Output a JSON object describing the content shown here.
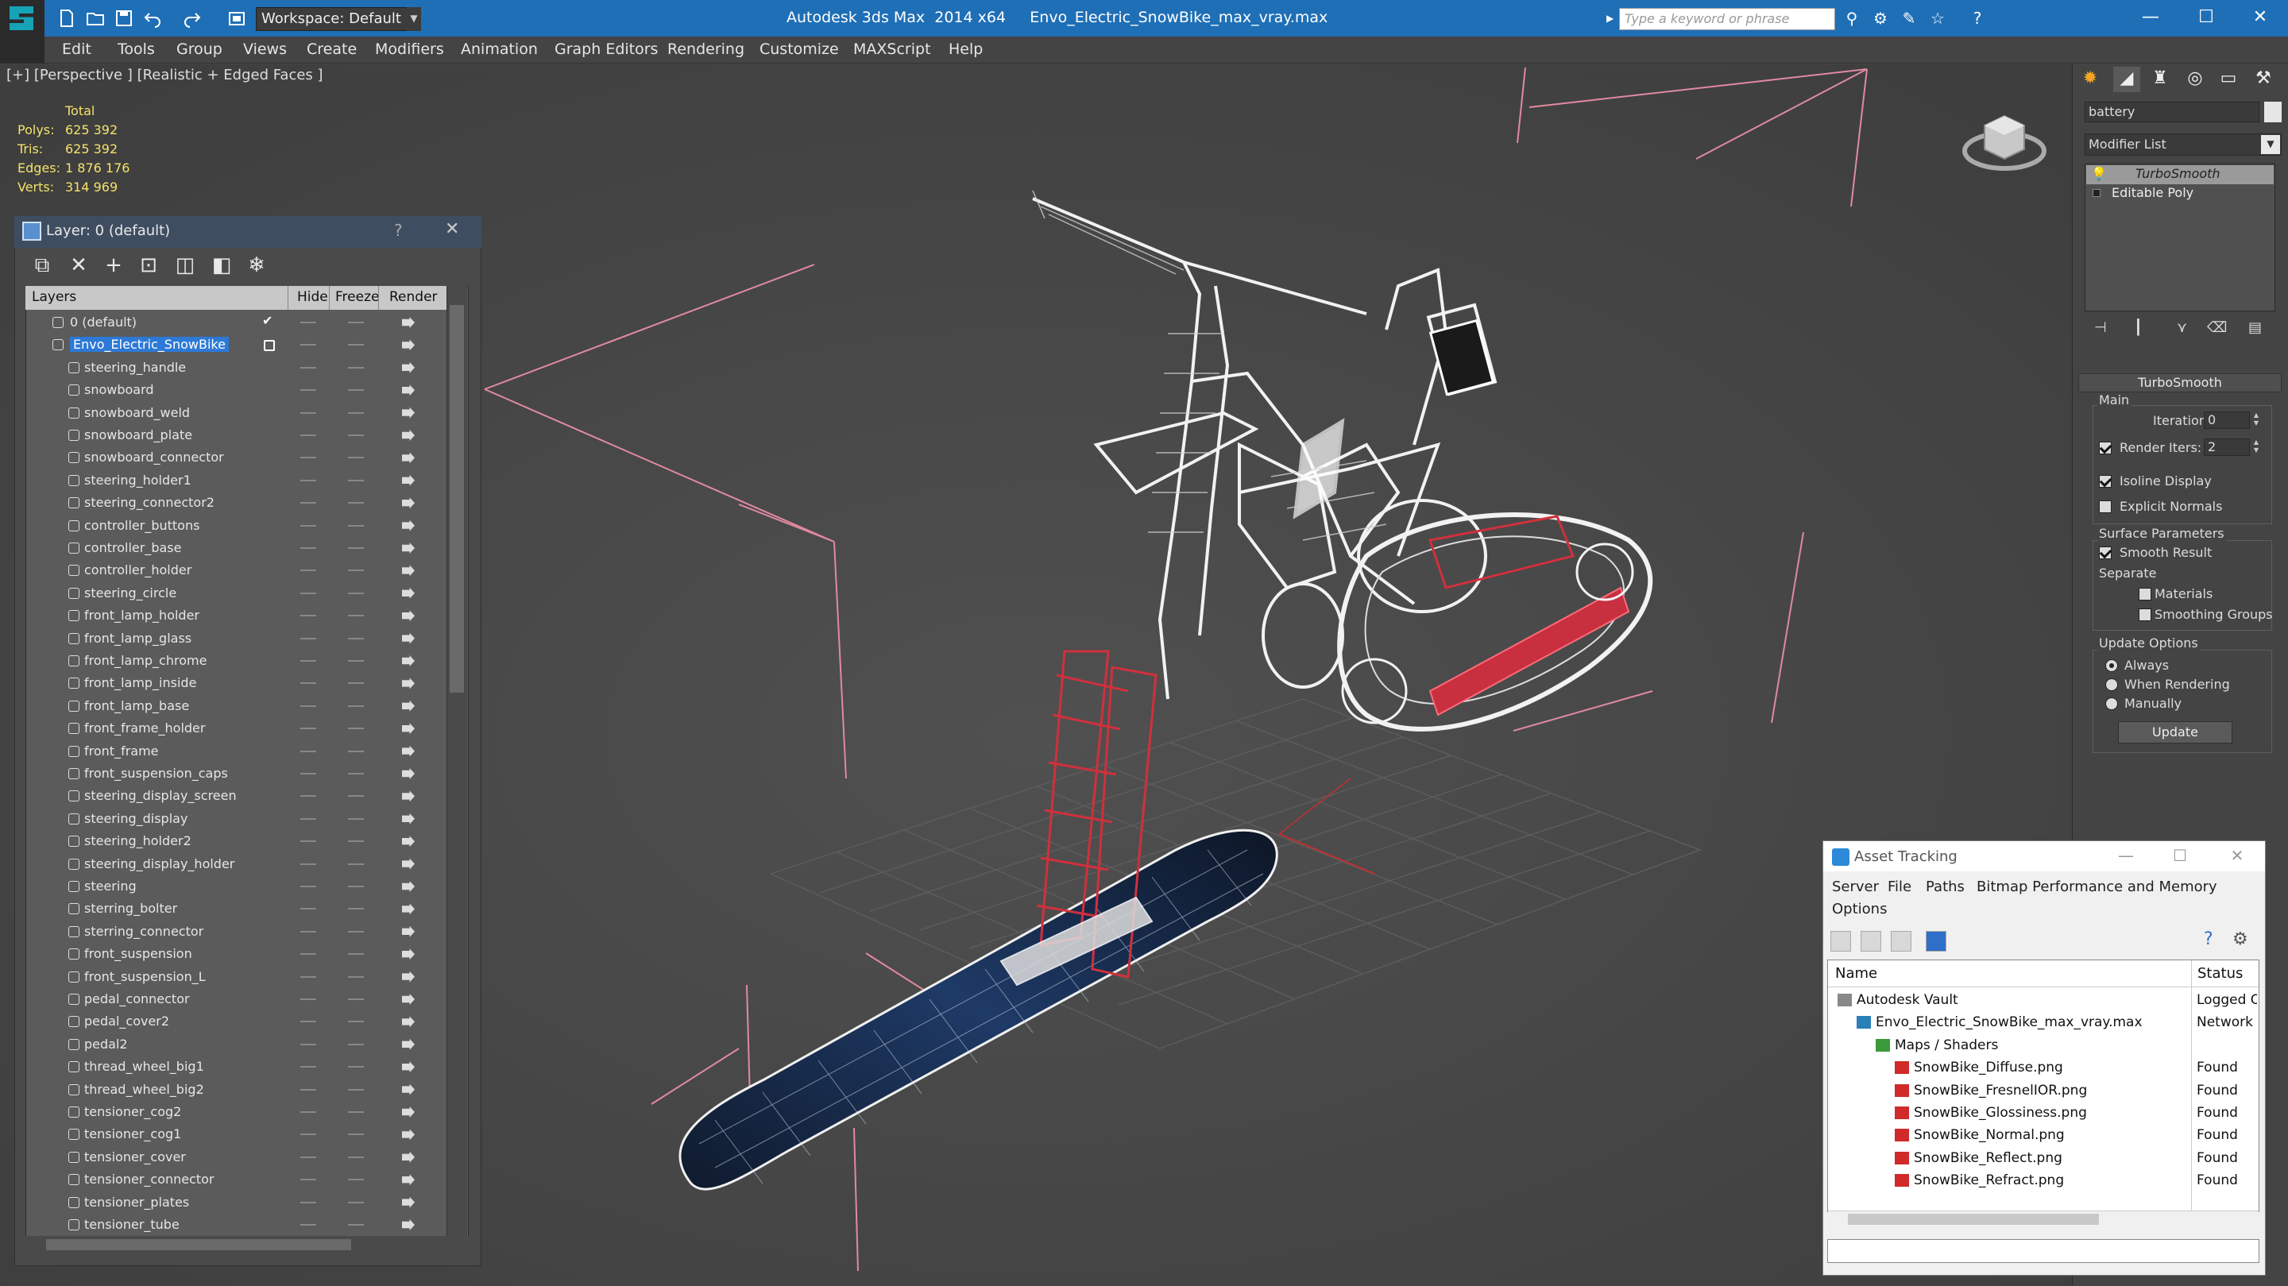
{
  "titlebar": {
    "workspace_label": "Workspace: Default",
    "app_title": "Autodesk 3ds Max  2014 x64",
    "file_title": "Envo_Electric_SnowBike_max_vray.max",
    "search_placeholder": "Type a keyword or phrase",
    "accent": "#1f6fb6"
  },
  "menu": {
    "items": [
      "Edit",
      "Tools",
      "Group",
      "Views",
      "Create",
      "Modifiers",
      "Animation",
      "Graph Editors",
      "Rendering",
      "Customize",
      "MAXScript",
      "Help"
    ]
  },
  "viewport": {
    "label": "[+] [Perspective ] [Realistic + Edged Faces ]",
    "stats": {
      "total_label": "Total",
      "rows": [
        {
          "key": "Polys:",
          "value": "625 392"
        },
        {
          "key": "Tris:",
          "value": "625 392"
        },
        {
          "key": "Edges:",
          "value": "1 876 176"
        },
        {
          "key": "Verts:",
          "value": "314 969"
        }
      ]
    }
  },
  "layer_panel": {
    "title": "Layer: 0 (default)",
    "help": "?",
    "close": "✕",
    "columns": {
      "layers": "Layers",
      "hide": "Hide",
      "freeze": "Freeze",
      "render": "Render"
    },
    "rows": [
      {
        "name": "0 (default)",
        "level": 0,
        "checked": true
      },
      {
        "name": "Envo_Electric_SnowBike",
        "level": 0,
        "selected": true
      },
      {
        "name": "steering_handle",
        "level": 1
      },
      {
        "name": "snowboard",
        "level": 1
      },
      {
        "name": "snowboard_weld",
        "level": 1
      },
      {
        "name": "snowboard_plate",
        "level": 1
      },
      {
        "name": "snowboard_connector",
        "level": 1
      },
      {
        "name": "steering_holder1",
        "level": 1
      },
      {
        "name": "steering_connector2",
        "level": 1
      },
      {
        "name": "controller_buttons",
        "level": 1
      },
      {
        "name": "controller_base",
        "level": 1
      },
      {
        "name": "controller_holder",
        "level": 1
      },
      {
        "name": "steering_circle",
        "level": 1
      },
      {
        "name": "front_lamp_holder",
        "level": 1
      },
      {
        "name": "front_lamp_glass",
        "level": 1
      },
      {
        "name": "front_lamp_chrome",
        "level": 1
      },
      {
        "name": "front_lamp_inside",
        "level": 1
      },
      {
        "name": "front_lamp_base",
        "level": 1
      },
      {
        "name": "front_frame_holder",
        "level": 1
      },
      {
        "name": "front_frame",
        "level": 1
      },
      {
        "name": "front_suspension_caps",
        "level": 1
      },
      {
        "name": "steering_display_screen",
        "level": 1
      },
      {
        "name": "steering_display",
        "level": 1
      },
      {
        "name": "steering_holder2",
        "level": 1
      },
      {
        "name": "steering_display_holder",
        "level": 1
      },
      {
        "name": "steering",
        "level": 1
      },
      {
        "name": "sterring_bolter",
        "level": 1
      },
      {
        "name": "sterring_connector",
        "level": 1
      },
      {
        "name": "front_suspension",
        "level": 1
      },
      {
        "name": "front_suspension_L",
        "level": 1
      },
      {
        "name": "pedal_connector",
        "level": 1
      },
      {
        "name": "pedal_cover2",
        "level": 1
      },
      {
        "name": "pedal2",
        "level": 1
      },
      {
        "name": "thread_wheel_big1",
        "level": 1
      },
      {
        "name": "thread_wheel_big2",
        "level": 1
      },
      {
        "name": "tensioner_cog2",
        "level": 1
      },
      {
        "name": "tensioner_cog1",
        "level": 1
      },
      {
        "name": "tensioner_cover",
        "level": 1
      },
      {
        "name": "tensioner_connector",
        "level": 1
      },
      {
        "name": "tensioner_plates",
        "level": 1
      },
      {
        "name": "tensioner_tube",
        "level": 1
      }
    ]
  },
  "command_panel": {
    "object_name": "battery",
    "modifier_list": "Modifier List",
    "stack": [
      "TurboSmooth",
      "Editable Poly"
    ],
    "turbosmooth": {
      "title": "TurboSmooth",
      "main_group": "Main",
      "iterations_label": "Iterations:",
      "iterations_value": "0",
      "render_iters_label": "Render Iters:",
      "render_iters_value": "2",
      "render_iters_checked": true,
      "isoline_label": "Isoline Display",
      "isoline_checked": true,
      "explicit_normals_label": "Explicit Normals",
      "explicit_normals_checked": false,
      "surface_group": "Surface Parameters",
      "smooth_result_label": "Smooth Result",
      "smooth_result_checked": true,
      "separate_label": "Separate",
      "materials_label": "Materials",
      "smoothing_groups_label": "Smoothing Groups",
      "update_group": "Update Options",
      "always_label": "Always",
      "when_rendering_label": "When Rendering",
      "manually_label": "Manually",
      "update_option": "Always",
      "update_button": "Update"
    }
  },
  "asset_tracking": {
    "title": "Asset Tracking",
    "menu_row1": [
      "Server",
      "File",
      "Paths",
      "Bitmap Performance and Memory"
    ],
    "menu_row2": [
      "Options"
    ],
    "columns": {
      "name": "Name",
      "status": "Status"
    },
    "rows": [
      {
        "name": "Autodesk Vault",
        "status": "Logged Out",
        "indent": 0,
        "icon": "vault-icon"
      },
      {
        "name": "Envo_Electric_SnowBike_max_vray.max",
        "status": "Network Path",
        "indent": 1,
        "icon": "max-file-icon"
      },
      {
        "name": "Maps / Shaders",
        "status": "",
        "indent": 2,
        "icon": "maps-icon"
      },
      {
        "name": "SnowBike_Diffuse.png",
        "status": "Found",
        "indent": 3,
        "icon": "png-icon"
      },
      {
        "name": "SnowBike_FresnelIOR.png",
        "status": "Found",
        "indent": 3,
        "icon": "png-icon"
      },
      {
        "name": "SnowBike_Glossiness.png",
        "status": "Found",
        "indent": 3,
        "icon": "png-icon"
      },
      {
        "name": "SnowBike_Normal.png",
        "status": "Found",
        "indent": 3,
        "icon": "png-icon"
      },
      {
        "name": "SnowBike_Reflect.png",
        "status": "Found",
        "indent": 3,
        "icon": "png-icon"
      },
      {
        "name": "SnowBike_Refract.png",
        "status": "Found",
        "indent": 3,
        "icon": "png-icon"
      }
    ]
  }
}
